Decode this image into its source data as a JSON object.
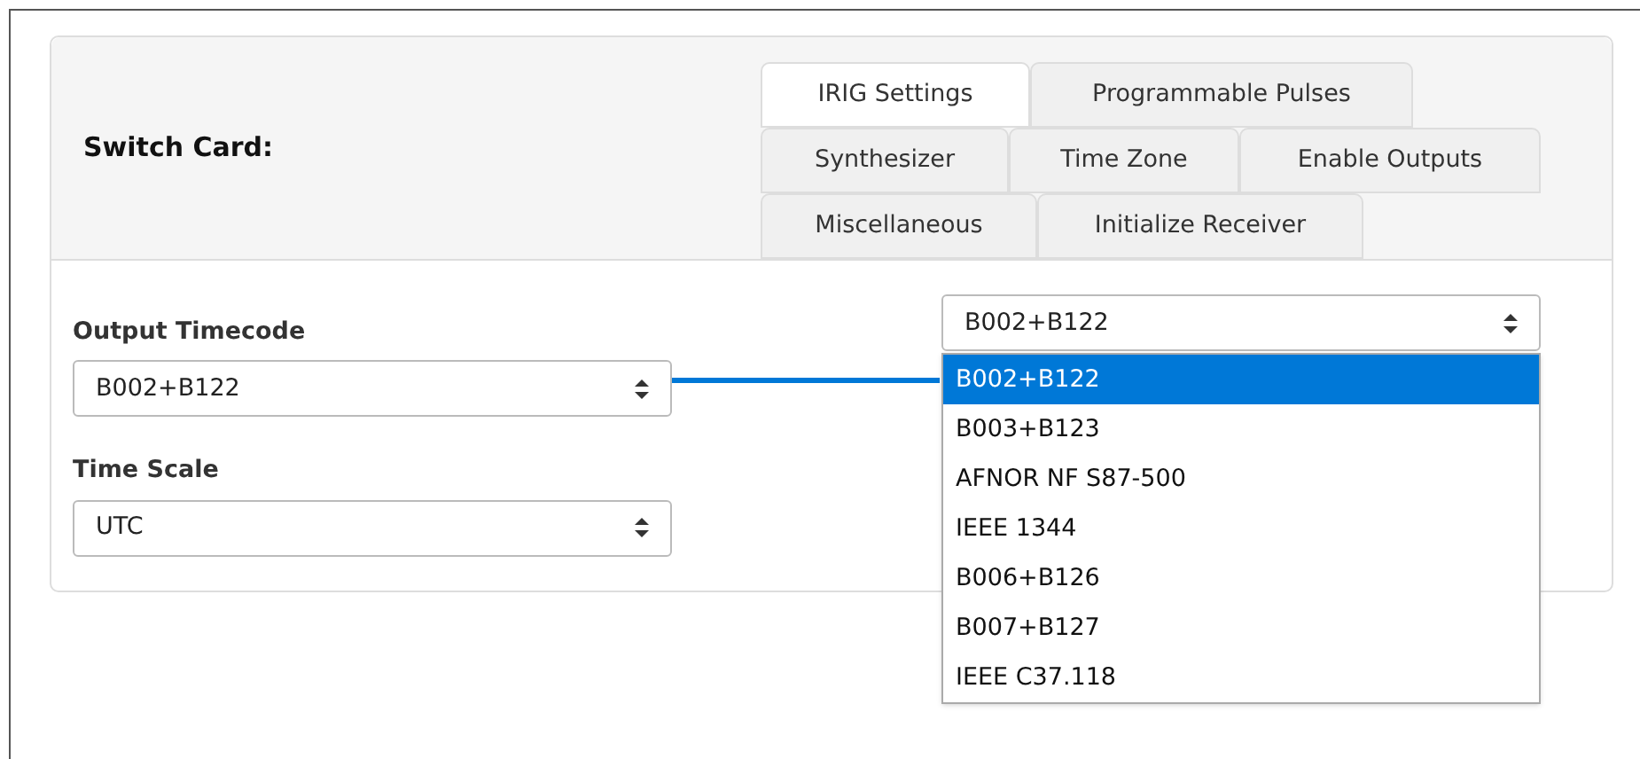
{
  "card": {
    "title": "Switch Card:"
  },
  "tabs": [
    [
      {
        "label": "IRIG Settings",
        "selected": true
      },
      {
        "label": "Programmable Pulses",
        "selected": false
      }
    ],
    [
      {
        "label": "Synthesizer",
        "selected": false
      },
      {
        "label": "Time Zone",
        "selected": false
      },
      {
        "label": "Enable Outputs",
        "selected": false
      }
    ],
    [
      {
        "label": "Miscellaneous",
        "selected": false
      },
      {
        "label": "Initialize Receiver",
        "selected": false
      }
    ]
  ],
  "fields": [
    {
      "label": "Output Timecode",
      "value": "B002+B122"
    },
    {
      "label": "Time Scale",
      "value": "UTC"
    }
  ],
  "dropdown": {
    "value": "B002+B122",
    "options": [
      {
        "label": "B002+B122",
        "selected": true
      },
      {
        "label": "B003+B123",
        "selected": false
      },
      {
        "label": "AFNOR NF S87-500",
        "selected": false
      },
      {
        "label": "IEEE 1344",
        "selected": false
      },
      {
        "label": "B006+B126",
        "selected": false
      },
      {
        "label": "B007+B127",
        "selected": false
      },
      {
        "label": "IEEE C37.118",
        "selected": false
      }
    ]
  }
}
